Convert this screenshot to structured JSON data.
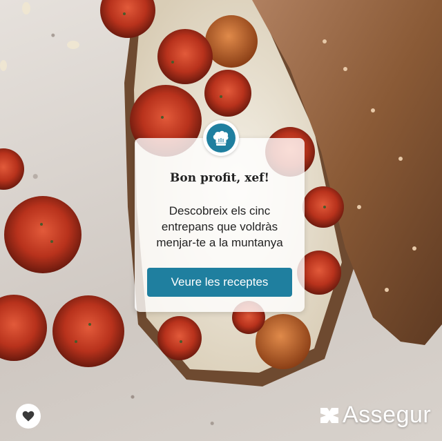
{
  "card": {
    "title": "Bon profit, xef!",
    "description_lines": [
      "Descobreix els cinc",
      "entrepans que voldràs",
      "menjar-te a la muntanya"
    ],
    "cta_label": "Veure les receptes"
  },
  "brand": {
    "name": "Assegur"
  },
  "icons": {
    "badge": "chef-hat-icon",
    "favorite": "heart-icon",
    "logo": "assegur-logo-icon"
  },
  "colors": {
    "accent": "#1f7f9f",
    "card_background": "rgba(255,255,255,0.80)",
    "tomato": "#b8321c",
    "bread": "#8a5a36"
  }
}
